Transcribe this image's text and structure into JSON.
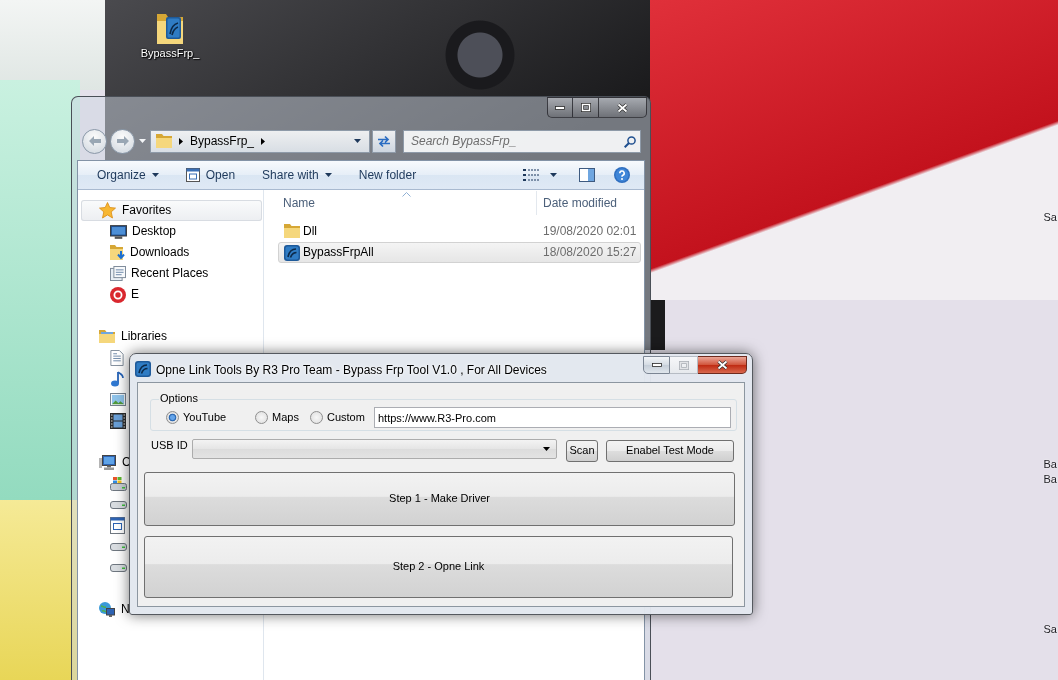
{
  "desktop": {
    "icons": [
      {
        "label": "BypassFrp_"
      }
    ],
    "edge_labels": [
      "Sa",
      "Ba",
      "Ba",
      "Sa"
    ]
  },
  "explorer": {
    "active": false,
    "window_buttons": [
      {
        "kind": "minimize",
        "disabled": false
      },
      {
        "kind": "maximize",
        "disabled": false
      },
      {
        "kind": "close",
        "disabled": false
      }
    ],
    "address": [
      "BypassFrp_"
    ],
    "search": {
      "placeholder": "Search BypassFrp_"
    },
    "toolbar": [
      {
        "label": "Organize",
        "kind": "menu"
      },
      {
        "label": "Open",
        "kind": "open"
      },
      {
        "label": "Share with",
        "kind": "menu"
      },
      {
        "label": "New folder",
        "kind": "plain"
      }
    ],
    "nav": [
      {
        "label": "Favorites",
        "kind": "star",
        "selected": true,
        "children": [
          {
            "label": "Desktop",
            "kind": "desktop",
            "selected": false
          },
          {
            "label": "Downloads",
            "kind": "downloads",
            "selected": false
          },
          {
            "label": "Recent Places",
            "kind": "recent",
            "selected": false
          },
          {
            "label": "E",
            "kind": "disc-logo",
            "selected": false
          }
        ]
      },
      {
        "label": "Libraries",
        "kind": "libraries",
        "selected": false,
        "children": [
          {
            "kind": "documents",
            "selected": false
          },
          {
            "kind": "music",
            "selected": false
          },
          {
            "kind": "pictures",
            "selected": false
          },
          {
            "kind": "videos",
            "selected": false
          }
        ]
      },
      {
        "label": "C",
        "kind": "computer",
        "selected": false,
        "children": [
          {
            "kind": "system-drive",
            "selected": false
          },
          {
            "kind": "drive",
            "selected": false
          },
          {
            "kind": "app",
            "selected": false
          },
          {
            "kind": "drive",
            "selected": false
          },
          {
            "kind": "drive",
            "selected": false
          }
        ]
      },
      {
        "label": "N",
        "kind": "network",
        "selected": false
      }
    ],
    "columns": [
      {
        "label": "Name",
        "sorted": true
      },
      {
        "label": "Date modified",
        "sorted": false
      }
    ],
    "files": [
      {
        "name": "Dll",
        "date": "19/08/2020 02:01",
        "kind": "folder",
        "selected": false
      },
      {
        "name": "BypassFrpAll",
        "date": "18/08/2020 15:27",
        "kind": "app",
        "selected": true
      }
    ]
  },
  "tool": {
    "active": true,
    "title": "Opne Link Tools By R3 Pro Team - Bypass Frp Tool V1.0 , For All Devices",
    "window_buttons": [
      {
        "kind": "minimize",
        "disabled": false
      },
      {
        "kind": "maximize",
        "disabled": true
      },
      {
        "kind": "close",
        "disabled": false
      }
    ],
    "options": {
      "legend": "Options",
      "radios": [
        {
          "label": "YouTube",
          "selected": true
        },
        {
          "label": "Maps",
          "selected": false
        },
        {
          "label": "Custom",
          "selected": false
        }
      ],
      "url": "https://www.R3-Pro.com"
    },
    "usb": {
      "label": "USB ID"
    },
    "buttons": [
      {
        "label": "Scan"
      },
      {
        "label": "Enabel Test Mode"
      }
    ],
    "steps": [
      {
        "label": "Step 1 - Make Driver"
      },
      {
        "label": "Step 2 - Opne Link"
      }
    ]
  }
}
